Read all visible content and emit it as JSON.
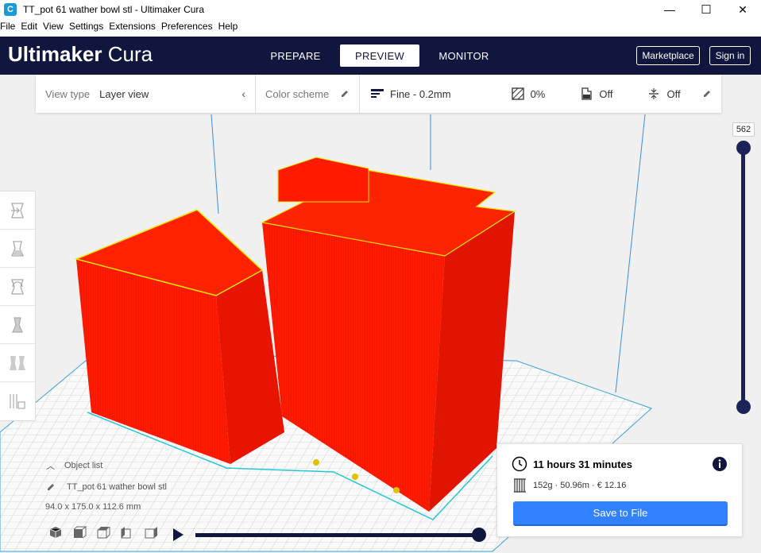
{
  "window": {
    "title": "TT_pot 61 wather bowl stl - Ultimaker Cura",
    "app_icon": "C",
    "minimize": "—",
    "maximize": "☐",
    "close": "✕"
  },
  "menu": [
    {
      "label": "File"
    },
    {
      "label": "Edit"
    },
    {
      "label": "View"
    },
    {
      "label": "Settings"
    },
    {
      "label": "Extensions"
    },
    {
      "label": "Preferences"
    },
    {
      "label": "Help"
    }
  ],
  "header": {
    "logo_bold": "Ultimaker",
    "logo_light": "Cura",
    "stages": [
      "PREPARE",
      "PREVIEW",
      "MONITOR"
    ],
    "active_stage": "PREVIEW",
    "marketplace": "Marketplace",
    "sign_in": "Sign in",
    "bg_color": "#10163d"
  },
  "view_settings": {
    "view_type_label": "View type",
    "view_type_value": "Layer view",
    "color_scheme_label": "Color scheme",
    "profile": "Fine - 0.2mm",
    "infill": "0%",
    "support": "Off",
    "adhesion": "Off"
  },
  "layer_slider": {
    "current_layer": "562",
    "color": "#1c2359"
  },
  "object": {
    "list_label": "Object list",
    "name": "TT_pot 61 wather bowl stl",
    "dimensions": "94.0 x 175.0 x 112.6 mm"
  },
  "print_info": {
    "time": "11 hours 31 minutes",
    "details": "152g · 50.96m · € 12.16",
    "save_button": "Save to File",
    "button_color": "#3282ff"
  },
  "model": {
    "color": "#ff1a00",
    "edge_color": "#e8e800"
  }
}
